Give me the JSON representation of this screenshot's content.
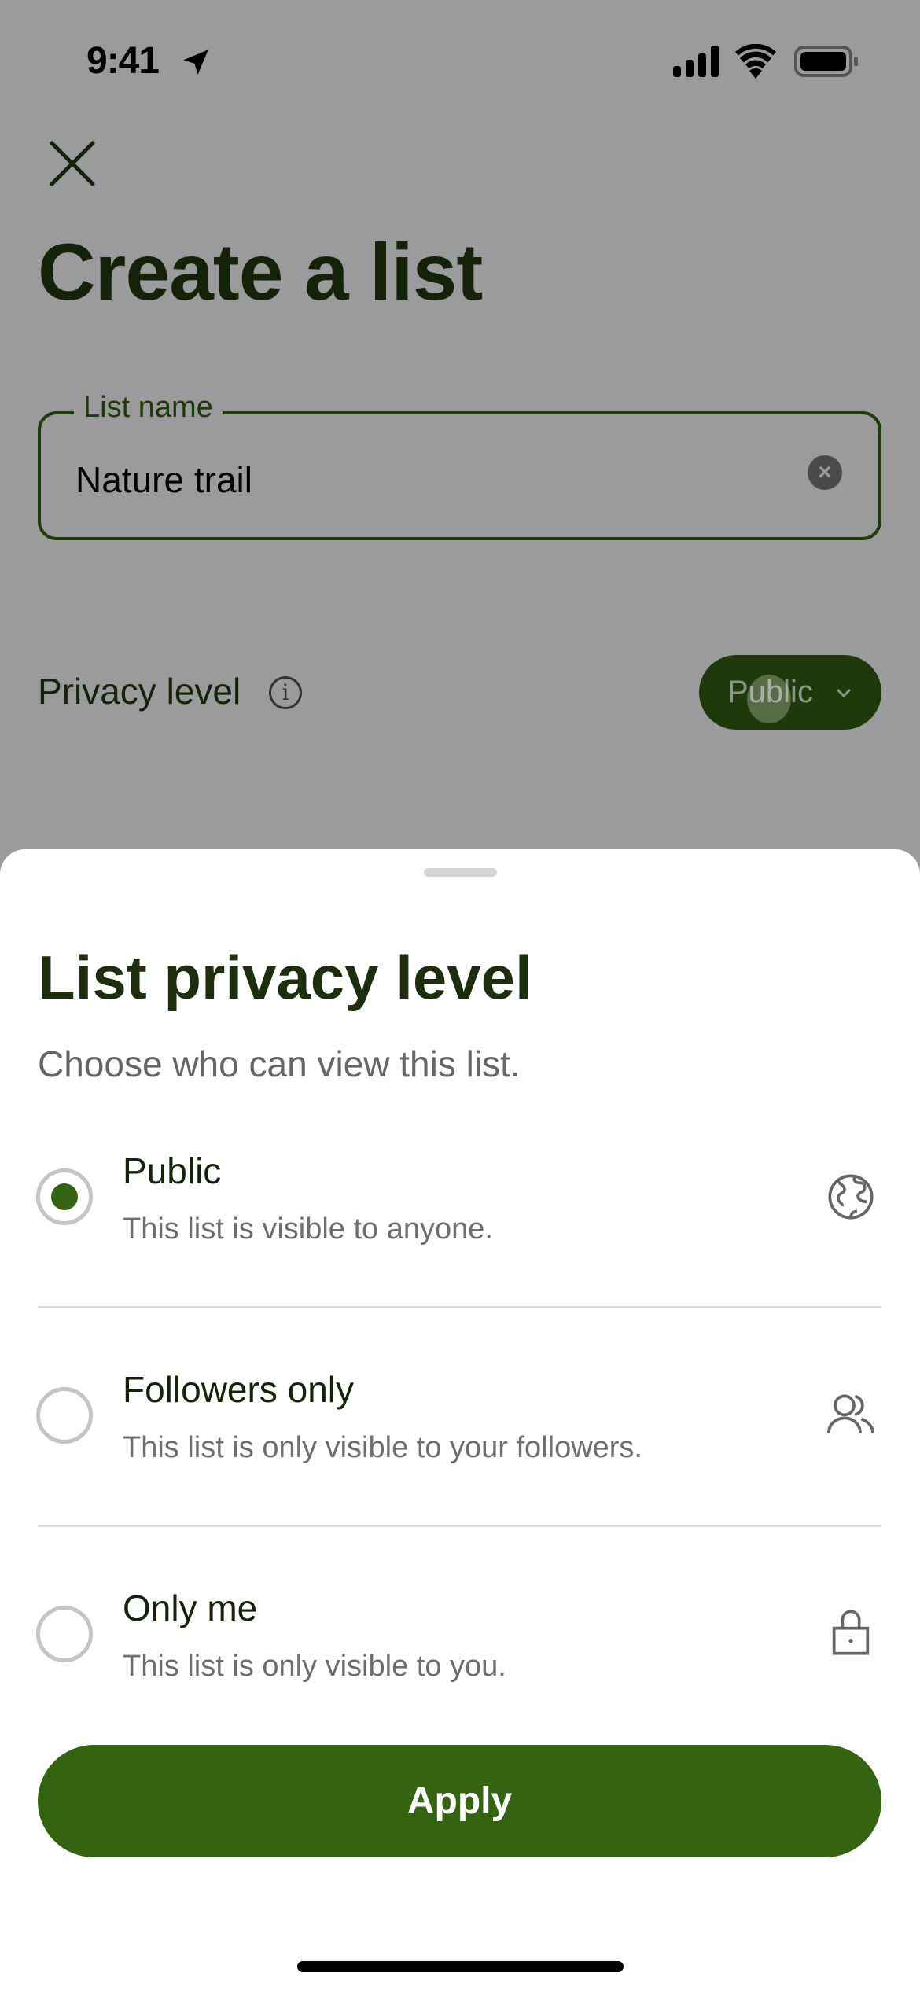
{
  "status_bar": {
    "time": "9:41",
    "icons": [
      "location-arrow-icon",
      "cellular-signal-icon",
      "wifi-icon",
      "battery-icon"
    ]
  },
  "page": {
    "title": "Create a list",
    "close_icon": "close-icon"
  },
  "list_name": {
    "label": "List name",
    "value": "Nature trail",
    "clear_icon": "clear-circle-icon"
  },
  "privacy": {
    "label": "Privacy level",
    "info_icon": "info-icon",
    "selected": "Public"
  },
  "sheet": {
    "title": "List privacy level",
    "subtitle": "Choose who can view this list.",
    "options": [
      {
        "title": "Public",
        "description": "This list is visible to anyone.",
        "icon": "globe-icon",
        "selected": true
      },
      {
        "title": "Followers only",
        "description": "This list is only visible to your followers.",
        "icon": "users-icon",
        "selected": false
      },
      {
        "title": "Only me",
        "description": "This list is only visible to you.",
        "icon": "lock-icon",
        "selected": false
      }
    ],
    "apply_label": "Apply"
  },
  "colors": {
    "accent": "#356312",
    "dark_green": "#1f3a0c",
    "overlay": "#9b9a9c"
  }
}
